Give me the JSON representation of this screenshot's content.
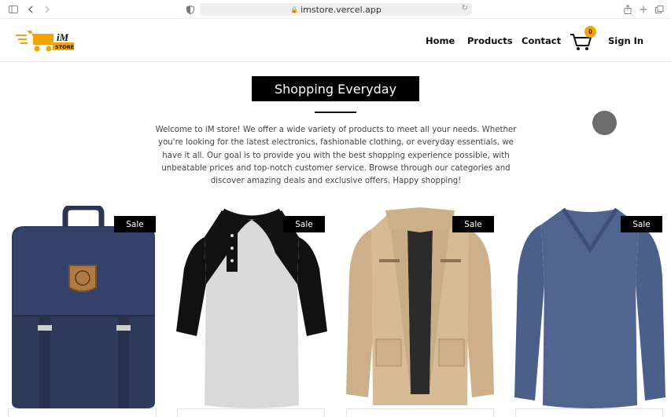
{
  "browser": {
    "url": "imstore.vercel.app"
  },
  "navbar": {
    "logo_text_top": "iM",
    "logo_text_bottom": "STORE",
    "links": [
      "Home",
      "Products",
      "Contact"
    ],
    "cart_count": "0",
    "sign_in": "Sign In"
  },
  "hero": {
    "title": "Shopping Everyday",
    "description": "Welcome to iM store! We offer a wide variety of products to meet all your needs. Whether you're looking for the latest electronics, fashionable clothing, or everyday essentials, we have it all. Our goal is to provide you with the best shopping experience possible, with unbeatable prices and top-notch customer service. Browse through our categories and discover amazing deals and exclusive offers. Happy shopping!"
  },
  "products": [
    {
      "badge": "Sale",
      "image": "navy-backpack"
    },
    {
      "badge": "Sale",
      "image": "raglan-henley-shirt"
    },
    {
      "badge": "Sale",
      "image": "khaki-jacket"
    },
    {
      "badge": "Sale",
      "image": "blue-vneck-sweater"
    }
  ],
  "colors": {
    "accent": "#f5a300",
    "hero_bg": "#000000",
    "backpack": "#2e3a5a",
    "jacket": "#d6bb94",
    "sweater": "#4f6590"
  }
}
